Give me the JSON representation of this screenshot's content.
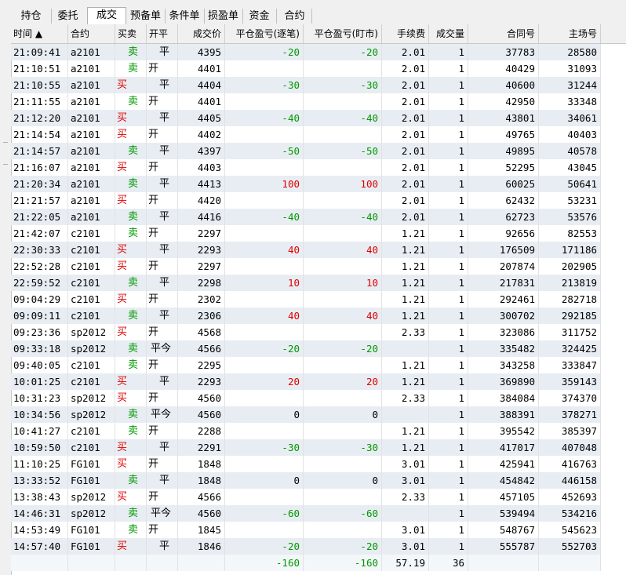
{
  "tabs": [
    {
      "label": "持仓",
      "active": false
    },
    {
      "label": "委托",
      "active": false
    },
    {
      "label": "成交",
      "active": true
    },
    {
      "label": "预备单",
      "active": false
    },
    {
      "label": "条件单",
      "active": false
    },
    {
      "label": "损盈单",
      "active": false
    },
    {
      "label": "资金",
      "active": false
    },
    {
      "label": "合约",
      "active": false
    }
  ],
  "columns": [
    {
      "label": "时间 ▲",
      "align": "l"
    },
    {
      "label": "合约",
      "align": "l"
    },
    {
      "label": "买卖",
      "align": "l"
    },
    {
      "label": "开平",
      "align": "l"
    },
    {
      "label": "成交价",
      "align": "r"
    },
    {
      "label": "平仓盈亏(逐笔)",
      "align": "r"
    },
    {
      "label": "平仓盈亏(盯市)",
      "align": "r"
    },
    {
      "label": "手续费",
      "align": "r"
    },
    {
      "label": "成交量",
      "align": "r"
    },
    {
      "label": "合同号",
      "align": "r"
    },
    {
      "label": "主场号",
      "align": "r"
    }
  ],
  "colors": {
    "buy": "#e00000",
    "sell": "#009900",
    "row_alt": "#e8edf3"
  },
  "rows": [
    [
      "21:09:41",
      "a2101",
      "卖",
      "平",
      "4395",
      "-20",
      "-20",
      "2.01",
      "1",
      "37783",
      "28580"
    ],
    [
      "21:10:51",
      "a2101",
      "卖",
      "开",
      "4401",
      "",
      "",
      "2.01",
      "1",
      "40429",
      "31093"
    ],
    [
      "21:10:55",
      "a2101",
      "买",
      "平",
      "4404",
      "-30",
      "-30",
      "2.01",
      "1",
      "40600",
      "31244"
    ],
    [
      "21:11:55",
      "a2101",
      "卖",
      "开",
      "4401",
      "",
      "",
      "2.01",
      "1",
      "42950",
      "33348"
    ],
    [
      "21:12:20",
      "a2101",
      "买",
      "平",
      "4405",
      "-40",
      "-40",
      "2.01",
      "1",
      "43801",
      "34061"
    ],
    [
      "21:14:54",
      "a2101",
      "买",
      "开",
      "4402",
      "",
      "",
      "2.01",
      "1",
      "49765",
      "40403"
    ],
    [
      "21:14:57",
      "a2101",
      "卖",
      "平",
      "4397",
      "-50",
      "-50",
      "2.01",
      "1",
      "49895",
      "40578"
    ],
    [
      "21:16:07",
      "a2101",
      "买",
      "开",
      "4403",
      "",
      "",
      "2.01",
      "1",
      "52295",
      "43045"
    ],
    [
      "21:20:34",
      "a2101",
      "卖",
      "平",
      "4413",
      "100",
      "100",
      "2.01",
      "1",
      "60025",
      "50641"
    ],
    [
      "21:21:57",
      "a2101",
      "买",
      "开",
      "4420",
      "",
      "",
      "2.01",
      "1",
      "62432",
      "53231"
    ],
    [
      "21:22:05",
      "a2101",
      "卖",
      "平",
      "4416",
      "-40",
      "-40",
      "2.01",
      "1",
      "62723",
      "53576"
    ],
    [
      "21:42:07",
      "c2101",
      "卖",
      "开",
      "2297",
      "",
      "",
      "1.21",
      "1",
      "92656",
      "82553"
    ],
    [
      "22:30:33",
      "c2101",
      "买",
      "平",
      "2293",
      "40",
      "40",
      "1.21",
      "1",
      "176509",
      "171186"
    ],
    [
      "22:52:28",
      "c2101",
      "买",
      "开",
      "2297",
      "",
      "",
      "1.21",
      "1",
      "207874",
      "202905"
    ],
    [
      "22:59:52",
      "c2101",
      "卖",
      "平",
      "2298",
      "10",
      "10",
      "1.21",
      "1",
      "217831",
      "213819"
    ],
    [
      "09:04:29",
      "c2101",
      "买",
      "开",
      "2302",
      "",
      "",
      "1.21",
      "1",
      "292461",
      "282718"
    ],
    [
      "09:09:11",
      "c2101",
      "卖",
      "平",
      "2306",
      "40",
      "40",
      "1.21",
      "1",
      "300702",
      "292185"
    ],
    [
      "09:23:36",
      "sp2012",
      "买",
      "开",
      "4568",
      "",
      "",
      "2.33",
      "1",
      "323086",
      "311752"
    ],
    [
      "09:33:18",
      "sp2012",
      "卖",
      "平今",
      "4566",
      "-20",
      "-20",
      "",
      "1",
      "335482",
      "324425"
    ],
    [
      "09:40:05",
      "c2101",
      "卖",
      "开",
      "2295",
      "",
      "",
      "1.21",
      "1",
      "343258",
      "333847"
    ],
    [
      "10:01:25",
      "c2101",
      "买",
      "平",
      "2293",
      "20",
      "20",
      "1.21",
      "1",
      "369890",
      "359143"
    ],
    [
      "10:31:23",
      "sp2012",
      "买",
      "开",
      "4560",
      "",
      "",
      "2.33",
      "1",
      "384084",
      "374370"
    ],
    [
      "10:34:56",
      "sp2012",
      "卖",
      "平今",
      "4560",
      "0",
      "0",
      "",
      "1",
      "388391",
      "378271"
    ],
    [
      "10:41:27",
      "c2101",
      "卖",
      "开",
      "2288",
      "",
      "",
      "1.21",
      "1",
      "395542",
      "385397"
    ],
    [
      "10:59:50",
      "c2101",
      "买",
      "平",
      "2291",
      "-30",
      "-30",
      "1.21",
      "1",
      "417017",
      "407048"
    ],
    [
      "11:10:25",
      "FG101",
      "买",
      "开",
      "1848",
      "",
      "",
      "3.01",
      "1",
      "425941",
      "416763"
    ],
    [
      "13:33:52",
      "FG101",
      "卖",
      "平",
      "1848",
      "0",
      "0",
      "3.01",
      "1",
      "454842",
      "446158"
    ],
    [
      "13:38:43",
      "sp2012",
      "买",
      "开",
      "4566",
      "",
      "",
      "2.33",
      "1",
      "457105",
      "452693"
    ],
    [
      "14:46:31",
      "sp2012",
      "卖",
      "平今",
      "4560",
      "-60",
      "-60",
      "",
      "1",
      "539494",
      "534216"
    ],
    [
      "14:53:49",
      "FG101",
      "卖",
      "开",
      "1845",
      "",
      "",
      "3.01",
      "1",
      "548767",
      "545623"
    ],
    [
      "14:57:40",
      "FG101",
      "买",
      "平",
      "1846",
      "-20",
      "-20",
      "3.01",
      "1",
      "555787",
      "552703"
    ]
  ],
  "totals": [
    "",
    "",
    "",
    "",
    "",
    "-160",
    "-160",
    "57.19",
    "36",
    "",
    ""
  ]
}
